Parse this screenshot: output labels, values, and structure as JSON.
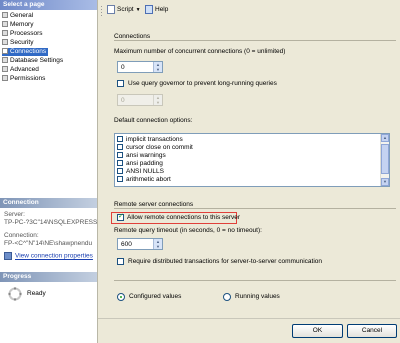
{
  "left": {
    "select_page_header": "Select a page",
    "pages": [
      {
        "label": "General"
      },
      {
        "label": "Memory"
      },
      {
        "label": "Processors"
      },
      {
        "label": "Security"
      },
      {
        "label": "Connections"
      },
      {
        "label": "Database Settings"
      },
      {
        "label": "Advanced"
      },
      {
        "label": "Permissions"
      }
    ],
    "connection_header": "Connection",
    "server_label": "Server:",
    "server_value": "TP-PC-?3C\"14\\NSQLEXPRESS",
    "connection_label": "Connection:",
    "connection_value": "FP-<C^\"N\"14\\NE\\shawpnendu",
    "view_properties_link": "View connection properties",
    "progress_header": "Progress",
    "progress_status": "Ready"
  },
  "toolbar": {
    "script_label": "Script",
    "help_label": "Help"
  },
  "main": {
    "connections_title": "Connections",
    "max_connections_label": "Maximum number of concurrent connections (0 = unlimited)",
    "max_connections_value": "0",
    "query_governor_label": "Use query governor to prevent long-running queries",
    "query_governor_checked": false,
    "query_governor_value": "0",
    "default_options_label": "Default connection options:",
    "default_options": [
      {
        "label": "implicit transactions"
      },
      {
        "label": "cursor close on commit"
      },
      {
        "label": "ansi warnings"
      },
      {
        "label": "ansi padding"
      },
      {
        "label": "ANSI NULLS"
      },
      {
        "label": "arithmetic abort"
      }
    ],
    "remote_title": "Remote server connections",
    "allow_remote_label": "Allow remote connections to this server",
    "allow_remote_checked": true,
    "remote_timeout_label": "Remote query timeout (in seconds, 0 = no timeout):",
    "remote_timeout_value": "600",
    "require_distributed_label": "Require distributed transactions for server-to-server communication",
    "require_distributed_checked": false,
    "configured_values_label": "Configured values",
    "running_values_label": "Running values",
    "selected_view": "configured"
  },
  "buttons": {
    "ok_label": "OK",
    "cancel_label": "Cancel"
  },
  "colors": {
    "selection": "#316ac5",
    "highlight_border": "#e0403a",
    "check": "#21a121"
  }
}
